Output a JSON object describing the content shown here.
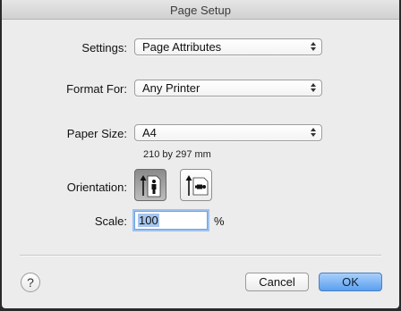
{
  "window": {
    "title": "Page Setup"
  },
  "settings": {
    "label": "Settings:",
    "value": "Page Attributes"
  },
  "format_for": {
    "label": "Format For:",
    "value": "Any Printer"
  },
  "paper_size": {
    "label": "Paper Size:",
    "value": "A4",
    "dimensions": "210 by 297 mm"
  },
  "orientation": {
    "label": "Orientation:",
    "selected": "portrait"
  },
  "scale": {
    "label": "Scale:",
    "value": "100",
    "unit": "%"
  },
  "buttons": {
    "help": "?",
    "cancel": "Cancel",
    "ok": "OK"
  },
  "colors": {
    "default_button": "#5a9ff0",
    "focus_ring": "#9cc2f0"
  }
}
